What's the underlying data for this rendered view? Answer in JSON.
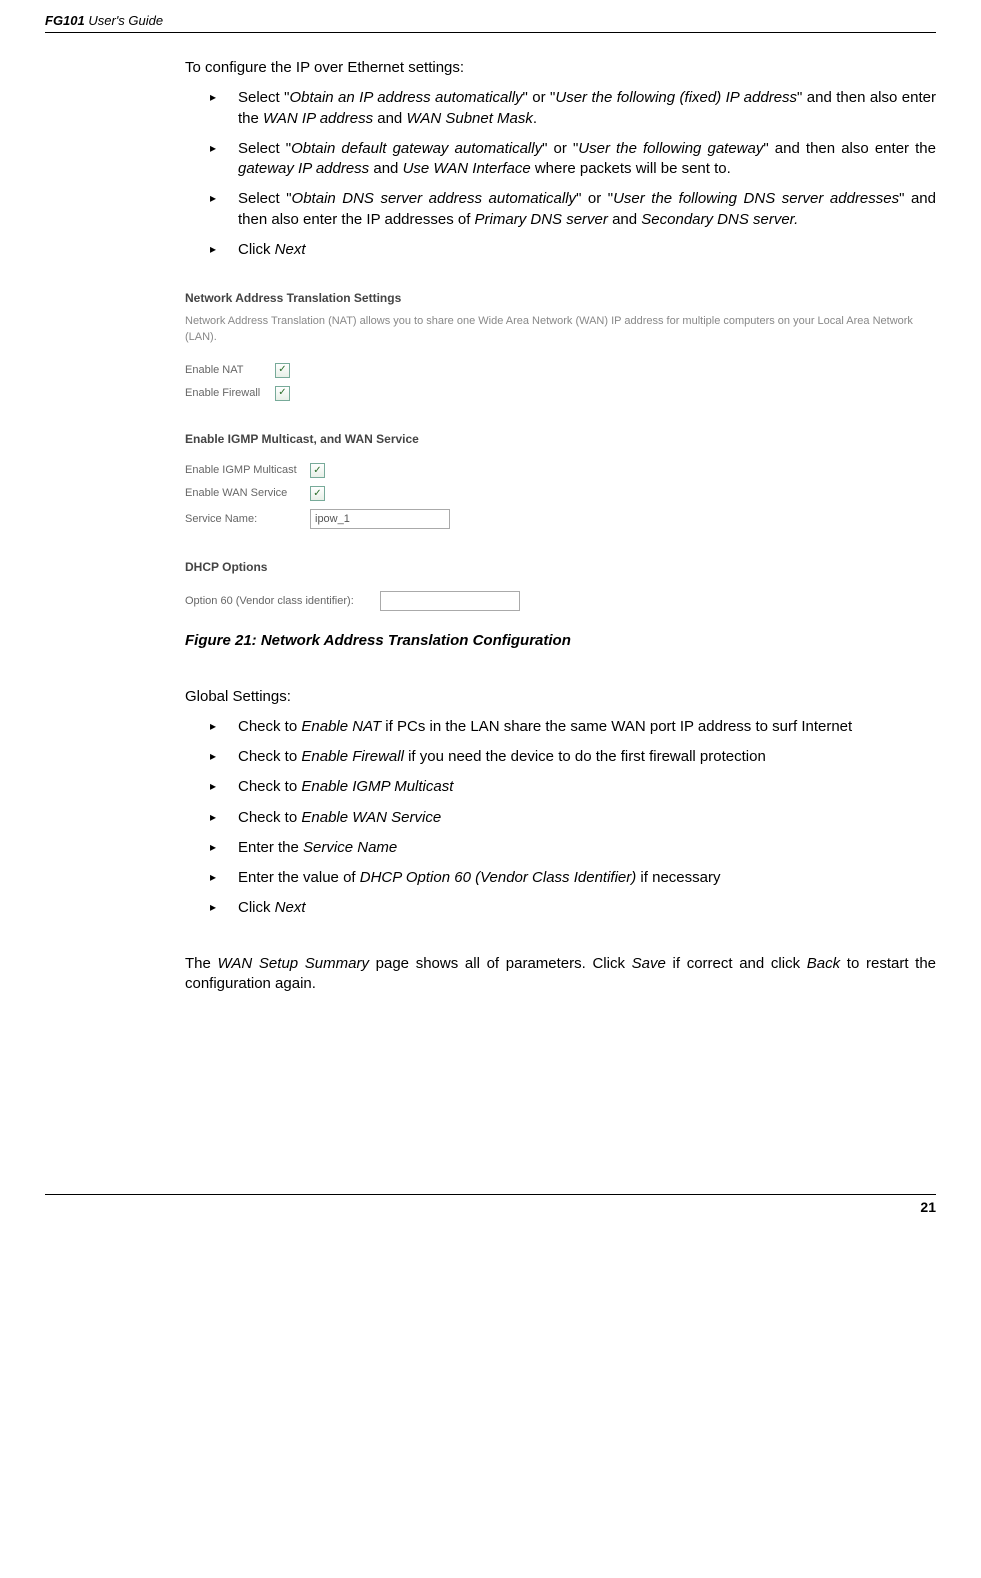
{
  "header": {
    "product": "FG101",
    "suffix": "User's Guide"
  },
  "intro1": "To configure the IP over Ethernet settings:",
  "bullets1": {
    "b1": {
      "pre": "Select \"",
      "i1": "Obtain an IP address automatically",
      "mid": "\" or \"",
      "i2": "User the following (fixed) IP address",
      "post": "\" and then also enter the ",
      "i3": "WAN IP address",
      "and": " and ",
      "i4": "WAN Subnet Mask",
      "end": "."
    },
    "b2": {
      "pre": "Select \"",
      "i1": "Obtain default gateway automatically",
      "mid": "\" or \"",
      "i2": "User the following gateway",
      "post": "\" and then also enter the ",
      "i3": "gateway IP address",
      "and": " and ",
      "i4": "Use WAN Interface",
      "end": " where packets will be sent to."
    },
    "b3": {
      "pre": "Select \"",
      "i1": "Obtain DNS server address automatically",
      "mid": "\" or \"",
      "i2": "User the following DNS server addresses",
      "post": "\" and then also enter the IP addresses of ",
      "i3": "Primary DNS server",
      "and": " and ",
      "i4": "Secondary DNS server.",
      "end": ""
    },
    "b4": {
      "pre": "Click ",
      "i1": "Next"
    }
  },
  "screenshot": {
    "title1": "Network Address Translation Settings",
    "desc": "Network Address Translation (NAT) allows you to share one Wide Area Network (WAN) IP address for multiple computers on your Local Area Network (LAN).",
    "enableNatLabel": "Enable NAT",
    "enableFirewallLabel": "Enable Firewall",
    "title2": "Enable IGMP Multicast, and WAN Service",
    "enableIgmpLabel": "Enable IGMP Multicast",
    "enableWanLabel": "Enable WAN Service",
    "serviceNameLabel": "Service Name:",
    "serviceNameValue": "ipow_1",
    "title3": "DHCP Options",
    "option60Label": "Option 60 (Vendor class identifier):",
    "option60Value": ""
  },
  "figureCaption": "Figure 21: Network Address Translation Configuration",
  "intro2": "Global Settings:",
  "bullets2": {
    "b1": {
      "pre": "Check to ",
      "i1": "Enable NAT",
      "post": " if PCs in the LAN share the same WAN port IP address to surf Internet"
    },
    "b2": {
      "pre": "Check to ",
      "i1": "Enable Firewall",
      "post": " if you need the device to do the first firewall protection"
    },
    "b3": {
      "pre": "Check to ",
      "i1": "Enable IGMP Multicast",
      "post": ""
    },
    "b4": {
      "pre": "Check to ",
      "i1": "Enable WAN Service",
      "post": ""
    },
    "b5": {
      "pre": "Enter the ",
      "i1": "Service Name",
      "post": ""
    },
    "b6": {
      "pre": "Enter the value of ",
      "i1": "DHCP Option 60 (Vendor Class Identifier)",
      "post": " if necessary"
    },
    "b7": {
      "pre": "Click ",
      "i1": "Next",
      "post": ""
    }
  },
  "para": {
    "p1": "The ",
    "i1": "WAN Setup Summary",
    "p2": " page shows all of parameters. Click ",
    "i2": "Save",
    "p3": " if correct and click ",
    "i3": "Back",
    "p4": " to restart the configuration again."
  },
  "pageNumber": "21"
}
